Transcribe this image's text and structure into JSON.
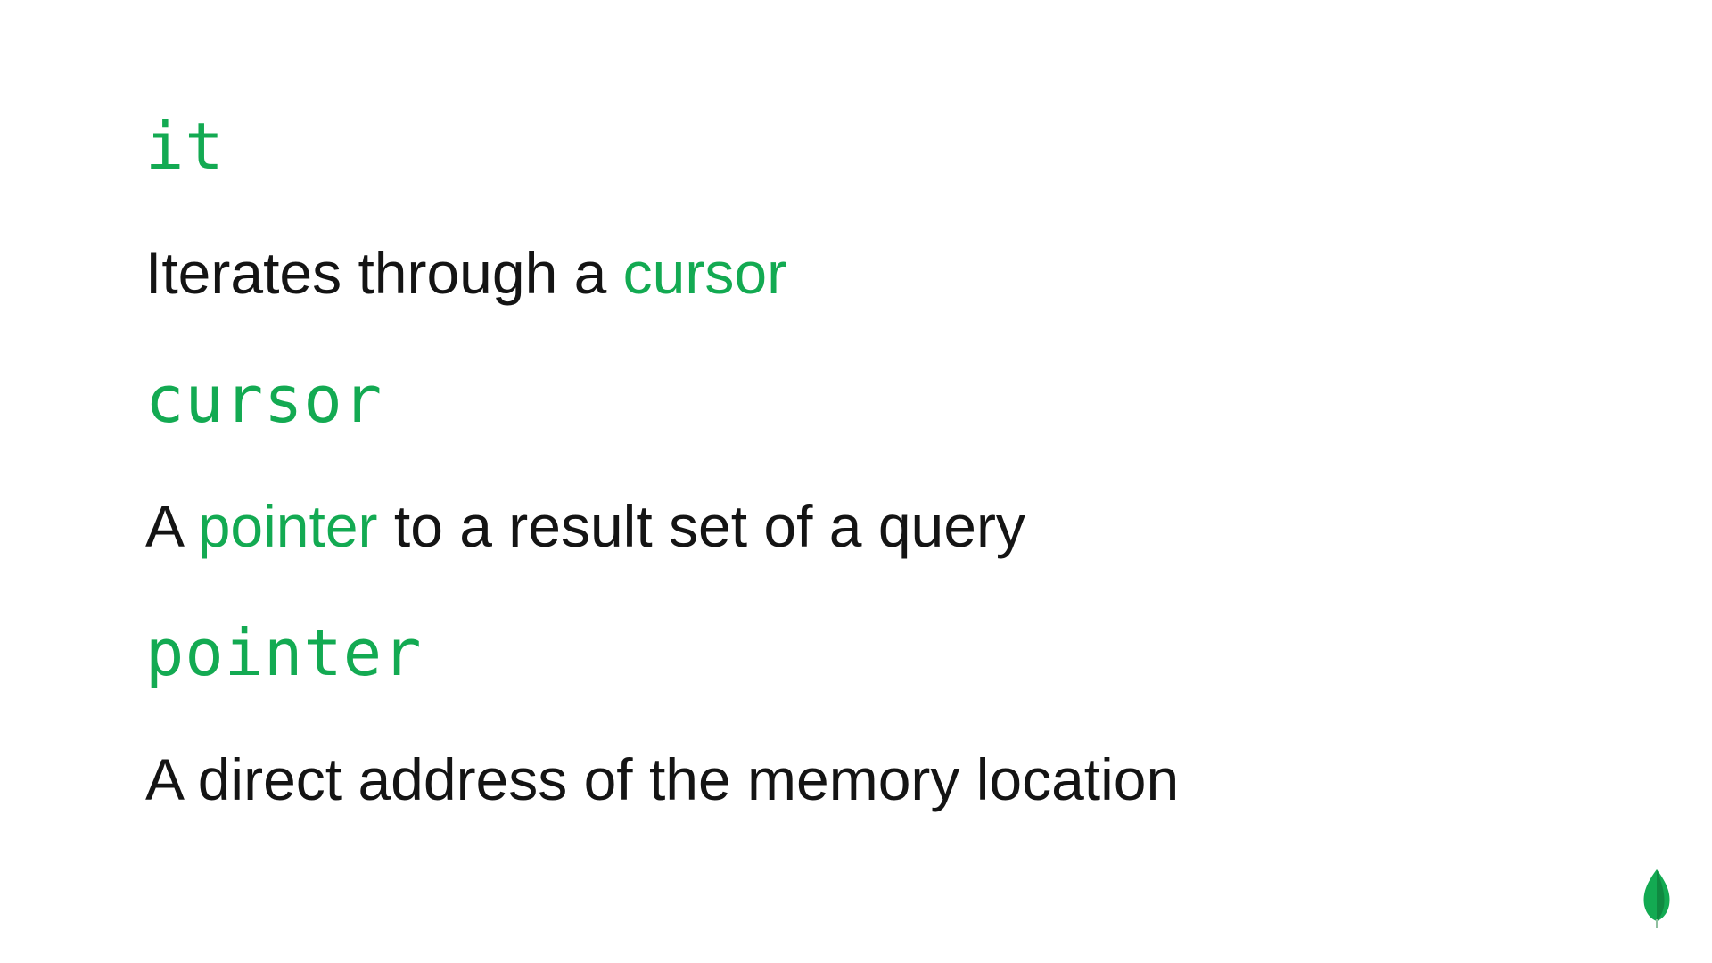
{
  "slide": {
    "entries": [
      {
        "term": "it",
        "definition": {
          "before": "Iterates through a ",
          "highlight": "cursor",
          "after": ""
        }
      },
      {
        "term": "cursor",
        "definition": {
          "before": "A ",
          "highlight": "pointer",
          "after": " to a result set of a query"
        }
      },
      {
        "term": "pointer",
        "definition": {
          "before": "A direct address of the memory location",
          "highlight": "",
          "after": ""
        }
      }
    ],
    "logo": {
      "icon": "mongodb-leaf-icon"
    }
  },
  "colors": {
    "accent": "#13aa52",
    "text": "#141414",
    "background": "#ffffff",
    "logo_green": "#13aa52",
    "logo_dark": "#0f8a41"
  }
}
